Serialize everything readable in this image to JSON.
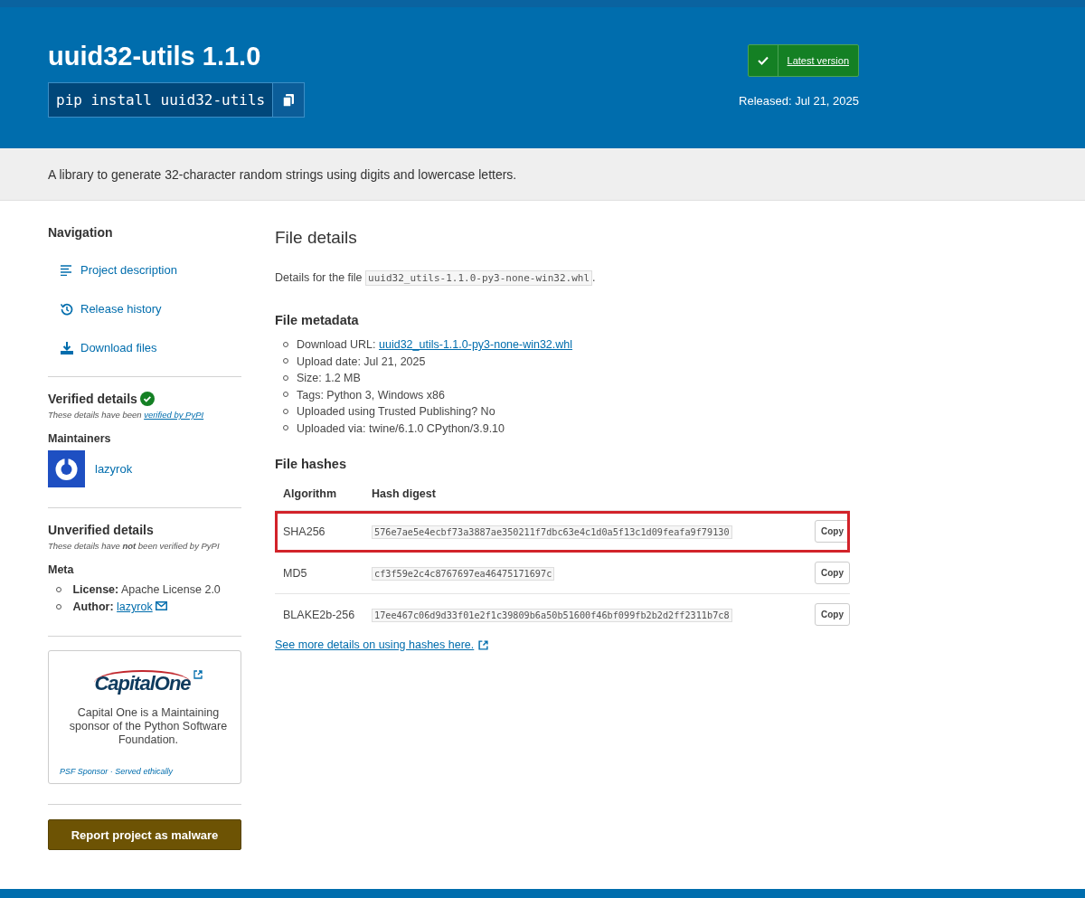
{
  "header": {
    "title": "uuid32-utils 1.1.0",
    "install_command": "pip install uuid32-utils",
    "latest_badge": {
      "label": "Latest version",
      "is_latest": true
    },
    "released": "Released: Jul 21, 2025"
  },
  "summary": "A library to generate 32-character random strings using digits and lowercase letters.",
  "sidebar": {
    "navigation_title": "Navigation",
    "nav_items": [
      {
        "label": "Project description",
        "kind": "description"
      },
      {
        "label": "Release history",
        "kind": "history"
      },
      {
        "label": "Download files",
        "kind": "download"
      }
    ],
    "verified_title": "Verified details",
    "verified_note_prefix": "These details have been",
    "verified_link": "verified by PyPI",
    "maintainers_title": "Maintainers",
    "maintainer": "lazyrok",
    "unverified_title": "Unverified details",
    "unverified_note": "These details have **not** been verified by PyPI",
    "meta_title": "Meta",
    "meta": [
      {
        "label": "License:",
        "value": "Apache License 2.0",
        "kind": "text"
      },
      {
        "label": "Author:",
        "value": "lazyrok",
        "kind": "email"
      }
    ],
    "sponsor": {
      "logo_text": "CapitalOne",
      "description": "Capital One is a Maintaining sponsor of the Python Software Foundation.",
      "footer": "PSF Sponsor · Served ethically"
    },
    "report_button": "Report project as malware"
  },
  "main": {
    "title": "File details",
    "details_prefix": "Details for the file",
    "filename": "uuid32_utils-1.1.0-py3-none-win32.whl",
    "details_suffix": ".",
    "metadata_title": "File metadata",
    "metadata": [
      {
        "label": "Download URL:",
        "link": "uuid32_utils-1.1.0-py3-none-win32.whl"
      },
      {
        "label": "Upload date: Jul 21, 2025"
      },
      {
        "label": "Size: 1.2 MB"
      },
      {
        "label": "Tags: Python 3, Windows x86"
      },
      {
        "label": "Uploaded using Trusted Publishing? No"
      },
      {
        "label": "Uploaded via: twine/6.1.0 CPython/3.9.10"
      }
    ],
    "hashes_title": "File hashes",
    "hash_columns": [
      "Algorithm",
      "Hash digest"
    ],
    "hashes": [
      {
        "algorithm": "SHA256",
        "digest": "576e7ae5e4ecbf73a3887ae350211f7dbc63e4c1d0a5f13c1d09feafa9f79130",
        "copy": "Copy",
        "highlighted": true
      },
      {
        "algorithm": "MD5",
        "digest": "cf3f59e2c4c8767697ea46475171697c",
        "copy": "Copy",
        "highlighted": false
      },
      {
        "algorithm": "BLAKE2b-256",
        "digest": "17ee467c06d9d33f01e2f1c39809b6a50b51600f46bf099fb2b2d2ff2311b7c8",
        "copy": "Copy",
        "highlighted": false
      }
    ],
    "hashes_link": "See more details on using hashes here."
  }
}
